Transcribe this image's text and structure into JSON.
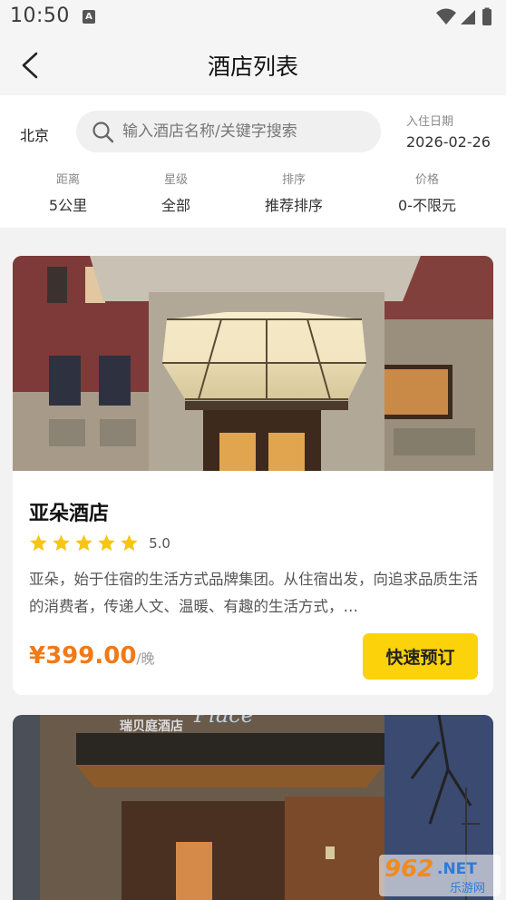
{
  "status_bar": {
    "time": "10:50",
    "notification_letter": "A"
  },
  "header": {
    "title": "酒店列表"
  },
  "filters": {
    "city": "北京",
    "search_placeholder": "输入酒店名称/关键字搜索",
    "checkin_label": "入住日期",
    "checkin_date": "2026-02-26",
    "options": [
      {
        "label": "距离",
        "value": "5公里"
      },
      {
        "label": "星级",
        "value": "全部"
      },
      {
        "label": "排序",
        "value": "推荐排序"
      },
      {
        "label": "价格",
        "value": "0-不限元"
      }
    ]
  },
  "hotels": [
    {
      "name": "亚朵酒店",
      "stars": 5,
      "rating": "5.0",
      "description": "亚朵，始于住宿的生活方式品牌集团。从住宿出发，向追求品质生活的消费者，传递人文、温暖、有趣的生活方式，…",
      "price": "¥399.00",
      "price_unit": "/晚",
      "book_label": "快速预订"
    },
    {
      "image_sign_text": "瑞贝庭酒店",
      "image_sign_brand": "Place"
    }
  ],
  "watermark": {
    "number": "962",
    "suffix": ".NET",
    "subtitle": "乐游网"
  },
  "colors": {
    "accent": "#fcd20a",
    "price": "#f07a18",
    "star": "#f7c513"
  }
}
